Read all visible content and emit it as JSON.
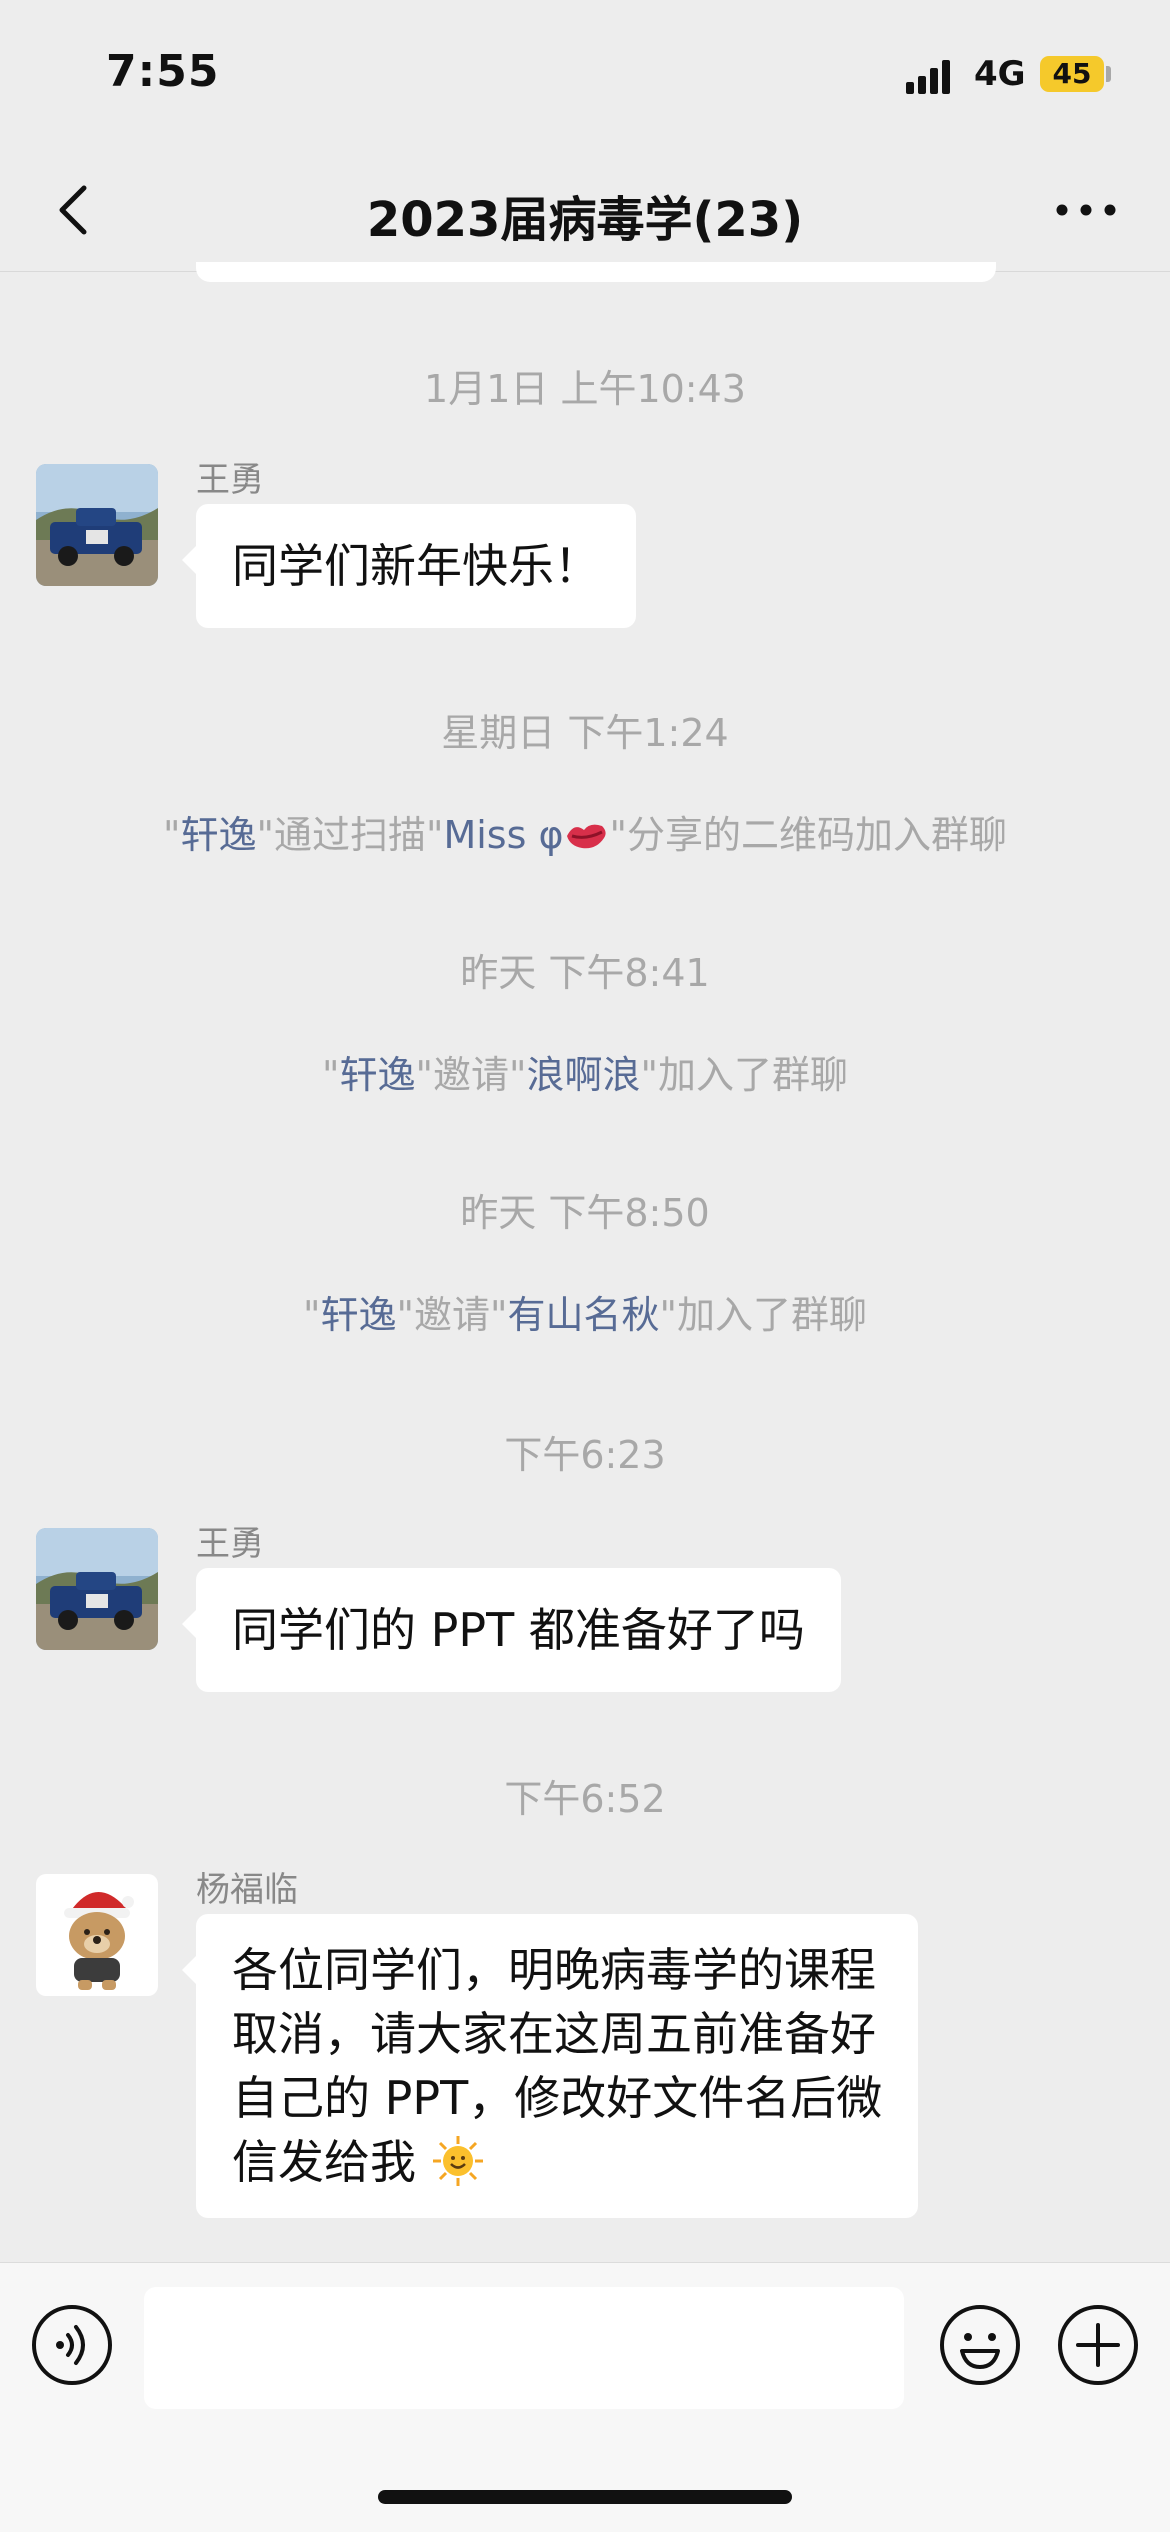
{
  "status_bar": {
    "time": "7:55",
    "network": "4G",
    "battery": "45"
  },
  "header": {
    "title": "2023届病毒学(23)",
    "back_icon": "chevron-left-icon",
    "more_icon": "ellipsis-icon"
  },
  "messages": {
    "ts1": "1月1日 上午10:43",
    "msg1": {
      "sender": "王勇",
      "text": "同学们新年快乐！"
    },
    "ts2": "星期日 下午1:24",
    "sys1": {
      "q1": "\"",
      "name1": "轩逸",
      "mid": "\"通过扫描\"",
      "name2": "Miss φ",
      "emoji": "kiss-mark-icon",
      "tail": "\"分享的二维码加入群聊"
    },
    "ts3": "昨天 下午8:41",
    "sys2": {
      "q1": "\"",
      "name1": "轩逸",
      "mid": "\"邀请\"",
      "name2": "浪啊浪",
      "tail": "\"加入了群聊"
    },
    "ts4": "昨天 下午8:50",
    "sys3": {
      "q1": "\"",
      "name1": "轩逸",
      "mid": "\"邀请\"",
      "name2": "有山名秋",
      "tail": "\"加入了群聊"
    },
    "ts5": "下午6:23",
    "msg2": {
      "sender": "王勇",
      "text": "同学们的 PPT 都准备好了吗"
    },
    "ts6": "下午6:52",
    "msg3": {
      "sender": "杨福临",
      "line1": "各位同学们，明晚病毒学的课程",
      "line2": "取消，请大家在这周五前准备好",
      "line3": "自己的 PPT，修改好文件名后微",
      "line4": "信发给我",
      "emoji": "sun-face-icon"
    }
  },
  "input_bar": {
    "voice_icon": "voice-icon",
    "emoji_icon": "smiley-icon",
    "plus_icon": "plus-icon",
    "input_value": ""
  },
  "colors": {
    "background": "#ededed",
    "bubble": "#ffffff",
    "link_name": "#576b95",
    "meta_text": "#a8a8a8"
  }
}
